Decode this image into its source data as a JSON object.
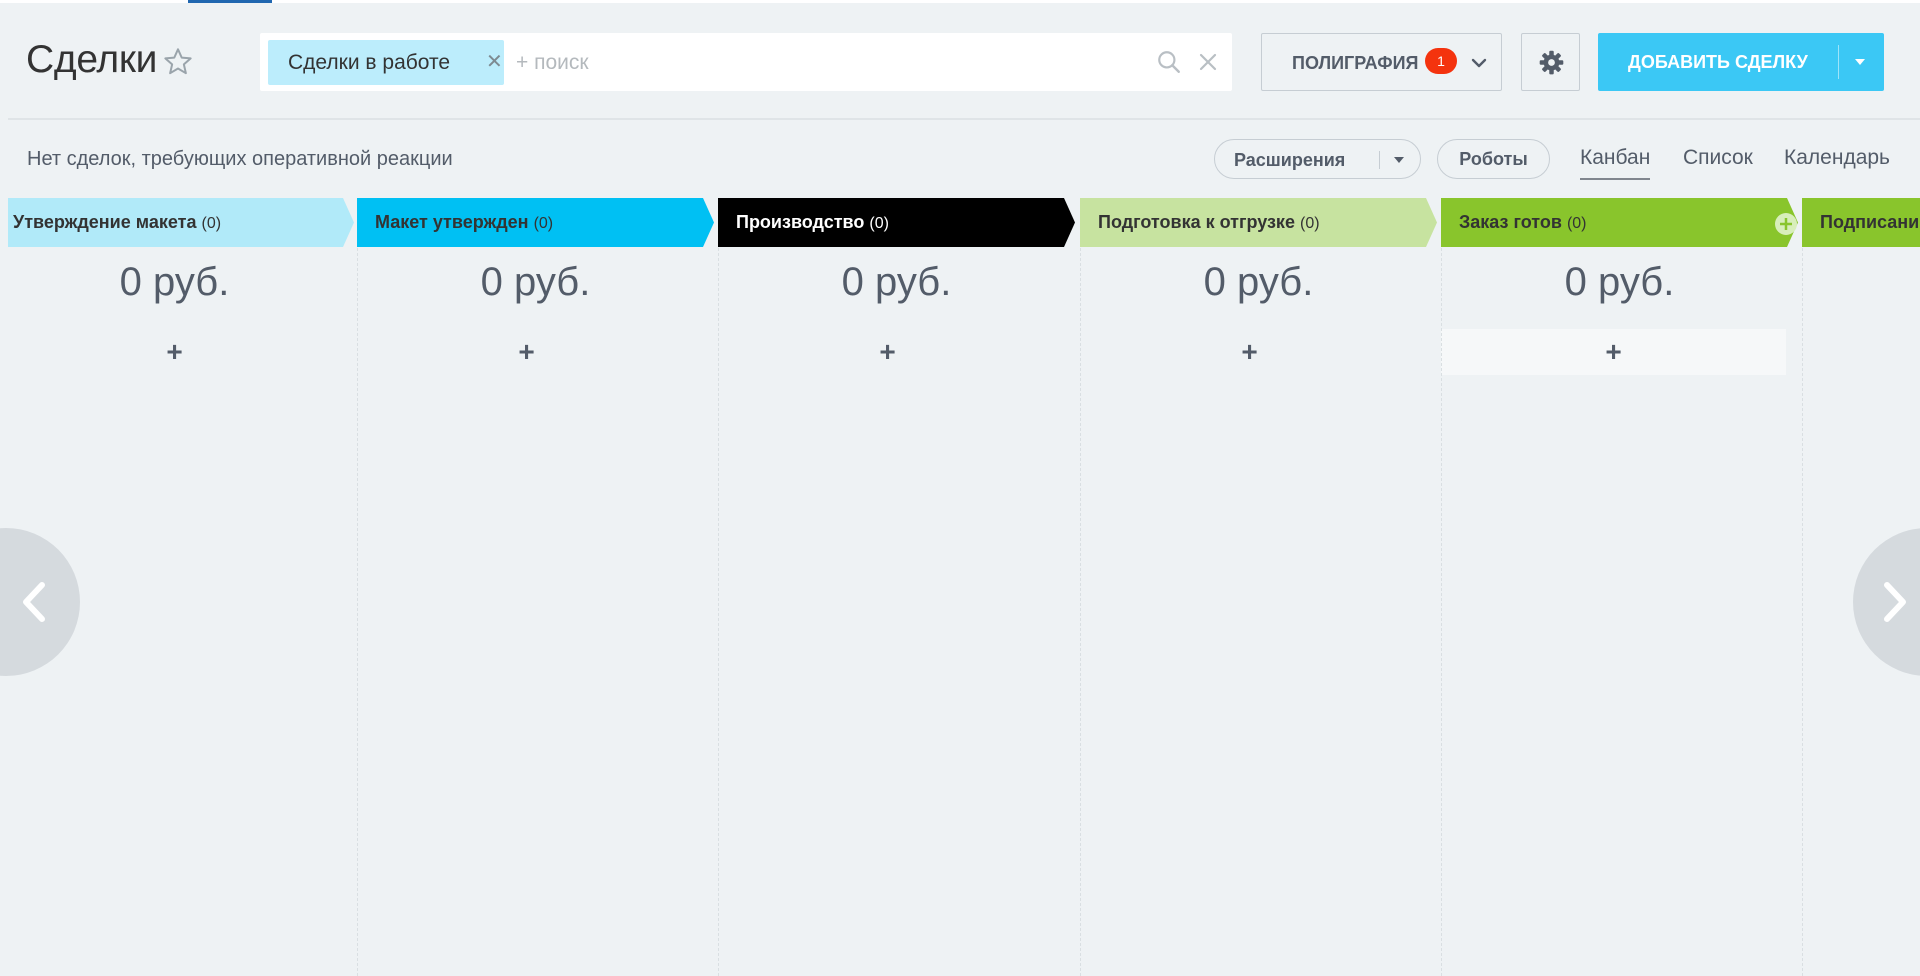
{
  "page": {
    "title": "Сделки"
  },
  "search": {
    "filter_chip_label": "Сделки в работе",
    "placeholder": "+ поиск"
  },
  "category": {
    "label": "ПОЛИГРАФИЯ",
    "badge": "1"
  },
  "add_deal": {
    "label": "ДОБАВИТЬ СДЕЛКУ"
  },
  "status_text": "Нет сделок, требующих оперативной реакции",
  "toolbar": {
    "extensions_label": "Расширения",
    "robots_label": "Роботы"
  },
  "view_tabs": [
    {
      "label": "Канбан",
      "active": true
    },
    {
      "label": "Список"
    },
    {
      "label": "Календарь"
    }
  ],
  "kanban": {
    "columns": [
      {
        "title": "Утверждение макета",
        "count": "(0)",
        "sum": "0 руб.",
        "add": "+",
        "color": "#b1eaf9",
        "text_color": "#333333"
      },
      {
        "title": "Макет утвержден",
        "count": "(0)",
        "sum": "0 руб.",
        "add": "+",
        "color": "#00c0f3",
        "text_color": "#333333"
      },
      {
        "title": "Производство",
        "count": "(0)",
        "sum": "0 руб.",
        "add": "+",
        "color": "#000000",
        "text_color": "#ffffff"
      },
      {
        "title": "Подготовка к отгрузке",
        "count": "(0)",
        "sum": "0 руб.",
        "add": "+",
        "color": "#c7e3a0",
        "text_color": "#333333"
      },
      {
        "title": "Заказ готов",
        "count": "(0)",
        "sum": "0 руб.",
        "add": "+",
        "color": "#89c52c",
        "text_color": "#333333"
      },
      {
        "title": "Подписани",
        "color": "#89c52c",
        "text_color": "#333333"
      }
    ]
  },
  "colors": {
    "background": "#eef2f4",
    "accent_button": "#3bc8f5",
    "badge": "#f4330e",
    "filter_chip": "#bcedfc"
  }
}
